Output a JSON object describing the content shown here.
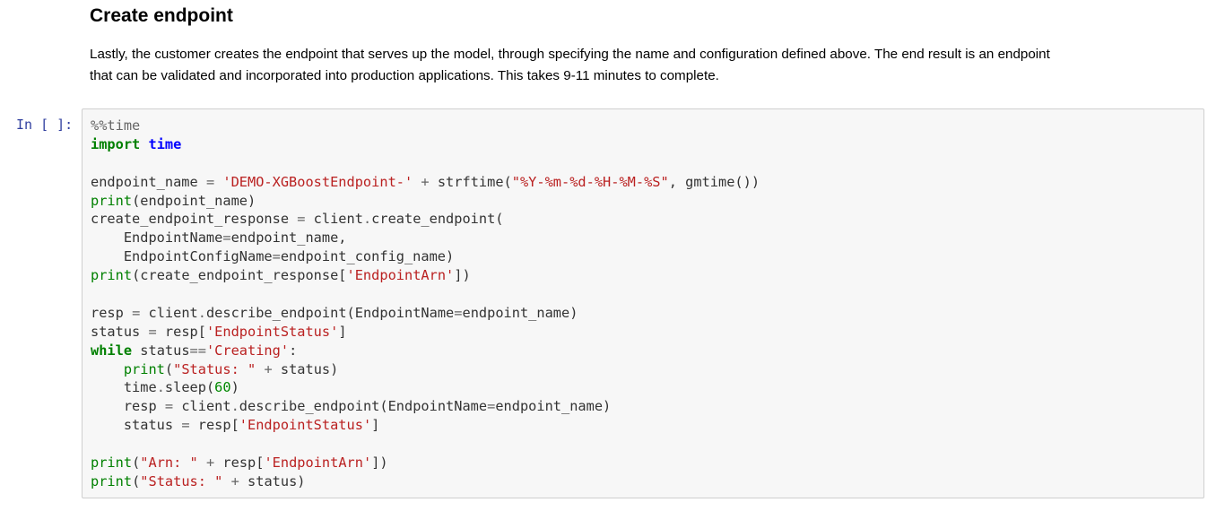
{
  "markdown": {
    "title": "Create endpoint",
    "paragraph_lines": [
      "Lastly, the customer creates the endpoint that serves up the model, through specifying the name and configuration defined above. The end result is an endpoint",
      "that can be validated and incorporated into production applications. This takes 9-11 minutes to complete."
    ]
  },
  "code_cell": {
    "prompt": "In [ ]:",
    "lines": [
      [
        {
          "t": "%%time",
          "c": "magic"
        }
      ],
      [
        {
          "t": "import",
          "c": "kw"
        },
        {
          "t": " "
        },
        {
          "t": "time",
          "c": "nm"
        }
      ],
      [],
      [
        {
          "t": "endpoint_name "
        },
        {
          "t": "=",
          "c": "op"
        },
        {
          "t": " "
        },
        {
          "t": "'DEMO-XGBoostEndpoint-'",
          "c": "str"
        },
        {
          "t": " "
        },
        {
          "t": "+",
          "c": "op"
        },
        {
          "t": " strftime("
        },
        {
          "t": "\"%Y-%m-%d-%H-%M-%S\"",
          "c": "str"
        },
        {
          "t": ", gmtime())"
        }
      ],
      [
        {
          "t": "print",
          "c": "bi"
        },
        {
          "t": "(endpoint_name)"
        }
      ],
      [
        {
          "t": "create_endpoint_response "
        },
        {
          "t": "=",
          "c": "op"
        },
        {
          "t": " client"
        },
        {
          "t": ".",
          "c": "op"
        },
        {
          "t": "create_endpoint("
        }
      ],
      [
        {
          "t": "    EndpointName"
        },
        {
          "t": "=",
          "c": "op"
        },
        {
          "t": "endpoint_name,"
        }
      ],
      [
        {
          "t": "    EndpointConfigName"
        },
        {
          "t": "=",
          "c": "op"
        },
        {
          "t": "endpoint_config_name)"
        }
      ],
      [
        {
          "t": "print",
          "c": "bi"
        },
        {
          "t": "(create_endpoint_response["
        },
        {
          "t": "'EndpointArn'",
          "c": "str"
        },
        {
          "t": "])"
        }
      ],
      [],
      [
        {
          "t": "resp "
        },
        {
          "t": "=",
          "c": "op"
        },
        {
          "t": " client"
        },
        {
          "t": ".",
          "c": "op"
        },
        {
          "t": "describe_endpoint(EndpointName"
        },
        {
          "t": "=",
          "c": "op"
        },
        {
          "t": "endpoint_name)"
        }
      ],
      [
        {
          "t": "status "
        },
        {
          "t": "=",
          "c": "op"
        },
        {
          "t": " resp["
        },
        {
          "t": "'EndpointStatus'",
          "c": "str"
        },
        {
          "t": "]"
        }
      ],
      [
        {
          "t": "while",
          "c": "kw"
        },
        {
          "t": " status"
        },
        {
          "t": "==",
          "c": "op"
        },
        {
          "t": "'Creating'",
          "c": "str"
        },
        {
          "t": ":"
        }
      ],
      [
        {
          "t": "    "
        },
        {
          "t": "print",
          "c": "bi"
        },
        {
          "t": "("
        },
        {
          "t": "\"Status: \"",
          "c": "str"
        },
        {
          "t": " "
        },
        {
          "t": "+",
          "c": "op"
        },
        {
          "t": " status)"
        }
      ],
      [
        {
          "t": "    time"
        },
        {
          "t": ".",
          "c": "op"
        },
        {
          "t": "sleep("
        },
        {
          "t": "60",
          "c": "num"
        },
        {
          "t": ")"
        }
      ],
      [
        {
          "t": "    resp "
        },
        {
          "t": "=",
          "c": "op"
        },
        {
          "t": " client"
        },
        {
          "t": ".",
          "c": "op"
        },
        {
          "t": "describe_endpoint(EndpointName"
        },
        {
          "t": "=",
          "c": "op"
        },
        {
          "t": "endpoint_name)"
        }
      ],
      [
        {
          "t": "    status "
        },
        {
          "t": "=",
          "c": "op"
        },
        {
          "t": " resp["
        },
        {
          "t": "'EndpointStatus'",
          "c": "str"
        },
        {
          "t": "]"
        }
      ],
      [],
      [
        {
          "t": "print",
          "c": "bi"
        },
        {
          "t": "("
        },
        {
          "t": "\"Arn: \"",
          "c": "str"
        },
        {
          "t": " "
        },
        {
          "t": "+",
          "c": "op"
        },
        {
          "t": " resp["
        },
        {
          "t": "'EndpointArn'",
          "c": "str"
        },
        {
          "t": "])"
        }
      ],
      [
        {
          "t": "print",
          "c": "bi"
        },
        {
          "t": "("
        },
        {
          "t": "\"Status: \"",
          "c": "str"
        },
        {
          "t": " "
        },
        {
          "t": "+",
          "c": "op"
        },
        {
          "t": " status)"
        }
      ]
    ]
  }
}
